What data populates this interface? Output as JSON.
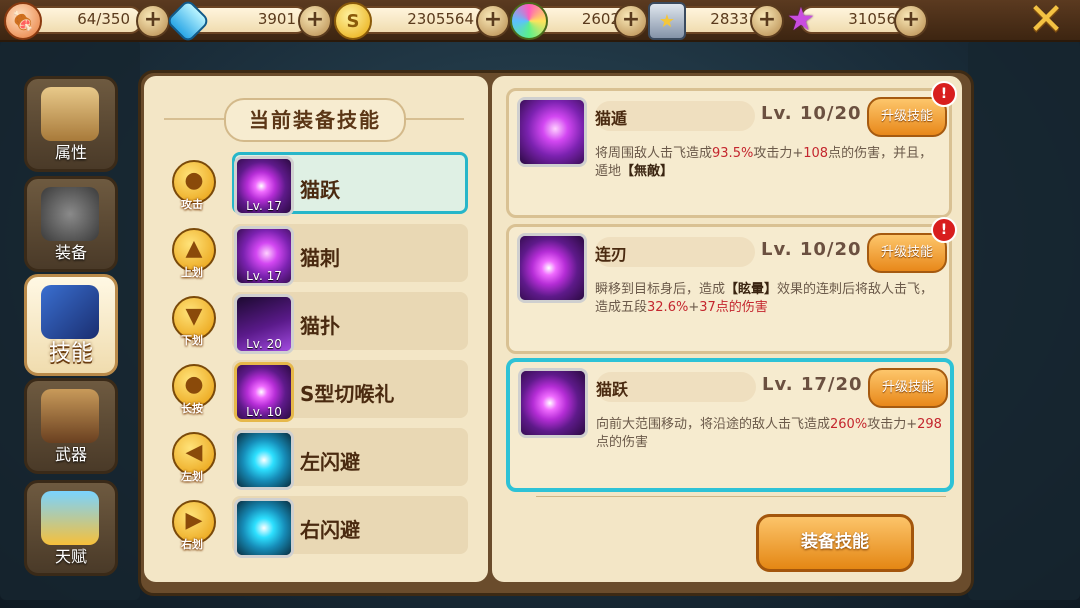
{
  "topbar": {
    "resources": [
      {
        "icon": "stamina-icon",
        "value": "64/350"
      },
      {
        "icon": "diamond-icon",
        "value": "3901"
      },
      {
        "icon": "gold-coin-icon",
        "value": "2305564"
      },
      {
        "icon": "candy-icon",
        "value": "2602"
      },
      {
        "icon": "honor-badge-icon",
        "value": "28337"
      },
      {
        "icon": "star-icon",
        "value": "31056"
      }
    ],
    "close_icon": "close-icon"
  },
  "nav": [
    {
      "label": "属性",
      "icon": "scroll-icon",
      "active": false
    },
    {
      "label": "装备",
      "icon": "helmet-icon",
      "active": false
    },
    {
      "label": "技能",
      "icon": "skill-book-icon",
      "active": true
    },
    {
      "label": "武器",
      "icon": "crossbow-icon",
      "active": false
    },
    {
      "label": "天赋",
      "icon": "talent-icon",
      "active": false
    }
  ],
  "left_panel": {
    "title": "当前装备技能",
    "skills": [
      {
        "control": "攻击",
        "name": "猫跃",
        "level": "Lv. 17",
        "selected": true
      },
      {
        "control": "上划",
        "name": "猫刺",
        "level": "Lv. 17",
        "selected": false
      },
      {
        "control": "下划",
        "name": "猫扑",
        "level": "Lv. 20",
        "selected": false
      },
      {
        "control": "长按",
        "name": "S型切喉礼",
        "level": "Lv. 10",
        "selected": false
      },
      {
        "control": "左划",
        "name": "左闪避",
        "level": "",
        "selected": false
      },
      {
        "control": "右划",
        "name": "右闪避",
        "level": "",
        "selected": false
      }
    ]
  },
  "right_panel": {
    "cards": [
      {
        "name": "猫遁",
        "level": "Lv. 10/20",
        "upgrade": "升级技能",
        "alert": "!",
        "desc": {
          "p1": "将周围敌人击飞造成",
          "v1": "93.5%",
          "p2": "攻击力+",
          "v2": "108",
          "p3": "点的伤害，并且，遁地",
          "b1": "【無敵】"
        }
      },
      {
        "name": "连刃",
        "level": "Lv. 10/20",
        "upgrade": "升级技能",
        "alert": "!",
        "desc": {
          "p1": "瞬移到目标身后，造成",
          "b1": "【眩暈】",
          "p2": "效果的连刺后将敌人击飞，造成五段",
          "v1": "32.6%",
          "p3": "+",
          "v2": "37",
          "p4": "点的伤害"
        }
      },
      {
        "name": "猫跃",
        "level": "Lv. 17/20",
        "upgrade": "升级技能",
        "desc": {
          "p1": "向前大范围移动，将沿途的敌人击飞造成",
          "v1": "260%",
          "p2": "攻击力+",
          "v2": "298",
          "p3": "点的伤害"
        }
      }
    ],
    "equip_button": "装备技能"
  }
}
